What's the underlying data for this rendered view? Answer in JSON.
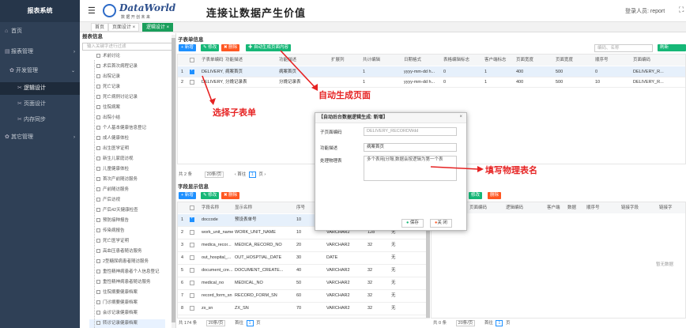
{
  "app": {
    "title": "报表系统"
  },
  "brand": {
    "logo_text": "DataWorld",
    "logo_sub": "数 据 开 创 未 来",
    "slogan": "连接让数据产生价值"
  },
  "user": {
    "label": "登录人员: report"
  },
  "sidebar": {
    "items": [
      {
        "label": "首页",
        "icon": "home-icon"
      },
      {
        "label": "报表管理",
        "icon": "report-icon"
      },
      {
        "label": "开发管理",
        "icon": "gear-icon"
      },
      {
        "label": "逻辑设计",
        "icon": "design-icon"
      },
      {
        "label": "页面设计",
        "icon": "design-icon"
      },
      {
        "label": "内存同步",
        "icon": "sync-icon"
      },
      {
        "label": "其它管理",
        "icon": "gear-icon"
      }
    ]
  },
  "tabs": [
    "首页",
    "页面设计 ×",
    "逻辑设计 ×"
  ],
  "tree": {
    "title": "报表信息",
    "search_placeholder": "输入关键字进行过滤",
    "items": [
      "术前讨论",
      "术后首次病程记录",
      "出院记录",
      "死亡记录",
      "死亡病例讨论记录",
      "住院病案",
      "出院小结",
      "个人基本健康信息登记",
      "成人健康体检",
      "出生医学证明",
      "新生儿家庭访视",
      "儿童健康体检",
      "首次产前随访服务",
      "产前随访服务",
      "产后访视",
      "产后42天健康检查",
      "预防接种报告",
      "传染病报告",
      "死亡医学证明",
      "高血压患者随访服务",
      "2型糖尿病患者随访服务",
      "重性精神病患者个人信息登记",
      "重性精神病患者随访服务",
      "住院摘要健康档案",
      "门诊摘要健康档案",
      "会诊记录健康档案",
      "转诊记录健康档案"
    ]
  },
  "top_section": {
    "title": "子表单信息",
    "buttons": [
      "+ 新增",
      "✎ 修改",
      "✖ 删除",
      "✚ 自动生成页面内容"
    ],
    "search_placeholder": "编码、名称",
    "right_btn": "刷新",
    "columns": [
      "子表单编码",
      "功能描述",
      "功能描述",
      "扩展列",
      "共计编辑",
      "日期格式",
      "表格编辑标志",
      "客户端标志",
      "页面宽度",
      "页面宽度",
      "顺序号",
      "页面编码"
    ],
    "rows": [
      {
        "n": "1",
        "checked": true,
        "cells": [
          "DELIVERY_R...",
          "病案首页",
          "病案首页",
          "",
          "1",
          "yyyy-mm-dd h...",
          "0",
          "1",
          "400",
          "500",
          "0",
          "DELIVERY_R..."
        ]
      },
      {
        "n": "2",
        "checked": false,
        "cells": [
          "DELIVERY_R...",
          "分娩记录表",
          "分娩记录表",
          "",
          "1",
          "yyyy-mm-dd h...",
          "0",
          "1",
          "400",
          "500",
          "10",
          "DELIVERY_R..."
        ]
      }
    ],
    "pager": {
      "total": "共 2 条",
      "size": "20条/页",
      "prev": "‹",
      "first": "首往",
      "page": "1",
      "next": "页",
      "next2": "›"
    }
  },
  "bottom_section": {
    "title": "字段显示信息",
    "buttons": [
      "+ 新增",
      "✎ 修改",
      "✖ 删除"
    ],
    "right_buttons": [
      "修改",
      "删除"
    ],
    "columns": [
      "字段名称",
      "显示名称",
      "序号",
      "数据类型",
      "长度",
      "隐藏"
    ],
    "rows": [
      {
        "n": "1",
        "checked": true,
        "cells": [
          "doccode",
          "预设表单号",
          "10",
          "",
          "",
          ""
        ]
      },
      {
        "n": "2",
        "checked": false,
        "cells": [
          "work_unit_name",
          "WORK_UNIT_NAME",
          "10",
          "VARCHAR2",
          "128",
          "无"
        ]
      },
      {
        "n": "3",
        "checked": false,
        "cells": [
          "medica_recor...",
          "MEDICA_RECORD_NO",
          "20",
          "VARCHAR2",
          "32",
          "无"
        ]
      },
      {
        "n": "4",
        "checked": false,
        "cells": [
          "out_hospital_...",
          "OUT_HOSPTIAL_DATE",
          "30",
          "DATE",
          "",
          "无"
        ]
      },
      {
        "n": "5",
        "checked": false,
        "cells": [
          "document_cre...",
          "DOCUMENT_CREATE...",
          "40",
          "VARCHAR2",
          "32",
          "无"
        ]
      },
      {
        "n": "6",
        "checked": false,
        "cells": [
          "medical_no",
          "MEDICAL_NO",
          "50",
          "VARCHAR2",
          "32",
          "无"
        ]
      },
      {
        "n": "7",
        "checked": false,
        "cells": [
          "record_form_sn",
          "RECORD_FORM_SN",
          "60",
          "VARCHAR2",
          "32",
          "无"
        ]
      },
      {
        "n": "8",
        "checked": false,
        "cells": [
          "zx_sn",
          "ZX_SN",
          "70",
          "VARCHAR2",
          "32",
          "无"
        ]
      }
    ],
    "pager": {
      "total": "共 174 条",
      "size": "20条/页",
      "first": "首往",
      "page": "1",
      "next": "页"
    },
    "right_columns": [
      "页面编码",
      "逻辑编码",
      "客户端",
      "数据",
      "顺序号",
      "链接字段",
      "链接字"
    ],
    "right_empty": "暂无数据",
    "right_pager": {
      "total": "共 0 条",
      "size": "20条/页",
      "first": "首往",
      "page": "1",
      "next": "页"
    }
  },
  "modal": {
    "title": "【自动后台数据逻辑生成: 新增】",
    "close": "×",
    "fields": [
      {
        "label": "子页面编码",
        "value": "DELIVERY_RECORDWdd"
      },
      {
        "label": "功能描述",
        "value": "病案首页"
      },
      {
        "label": "处理物理表",
        "value": "多个表用|分隔,数据会按逻辑为第一个表"
      }
    ],
    "save": "保存",
    "close_btn": "关 闭"
  },
  "annotations": {
    "select": "选择子表单",
    "auto": "自动生成页面",
    "fill": "填写物理表名"
  },
  "colors": {
    "sidebar": "#2f4056",
    "green": "#16b777",
    "blue": "#1e90ff",
    "red": "#ff5722",
    "annot": "#e62222"
  }
}
